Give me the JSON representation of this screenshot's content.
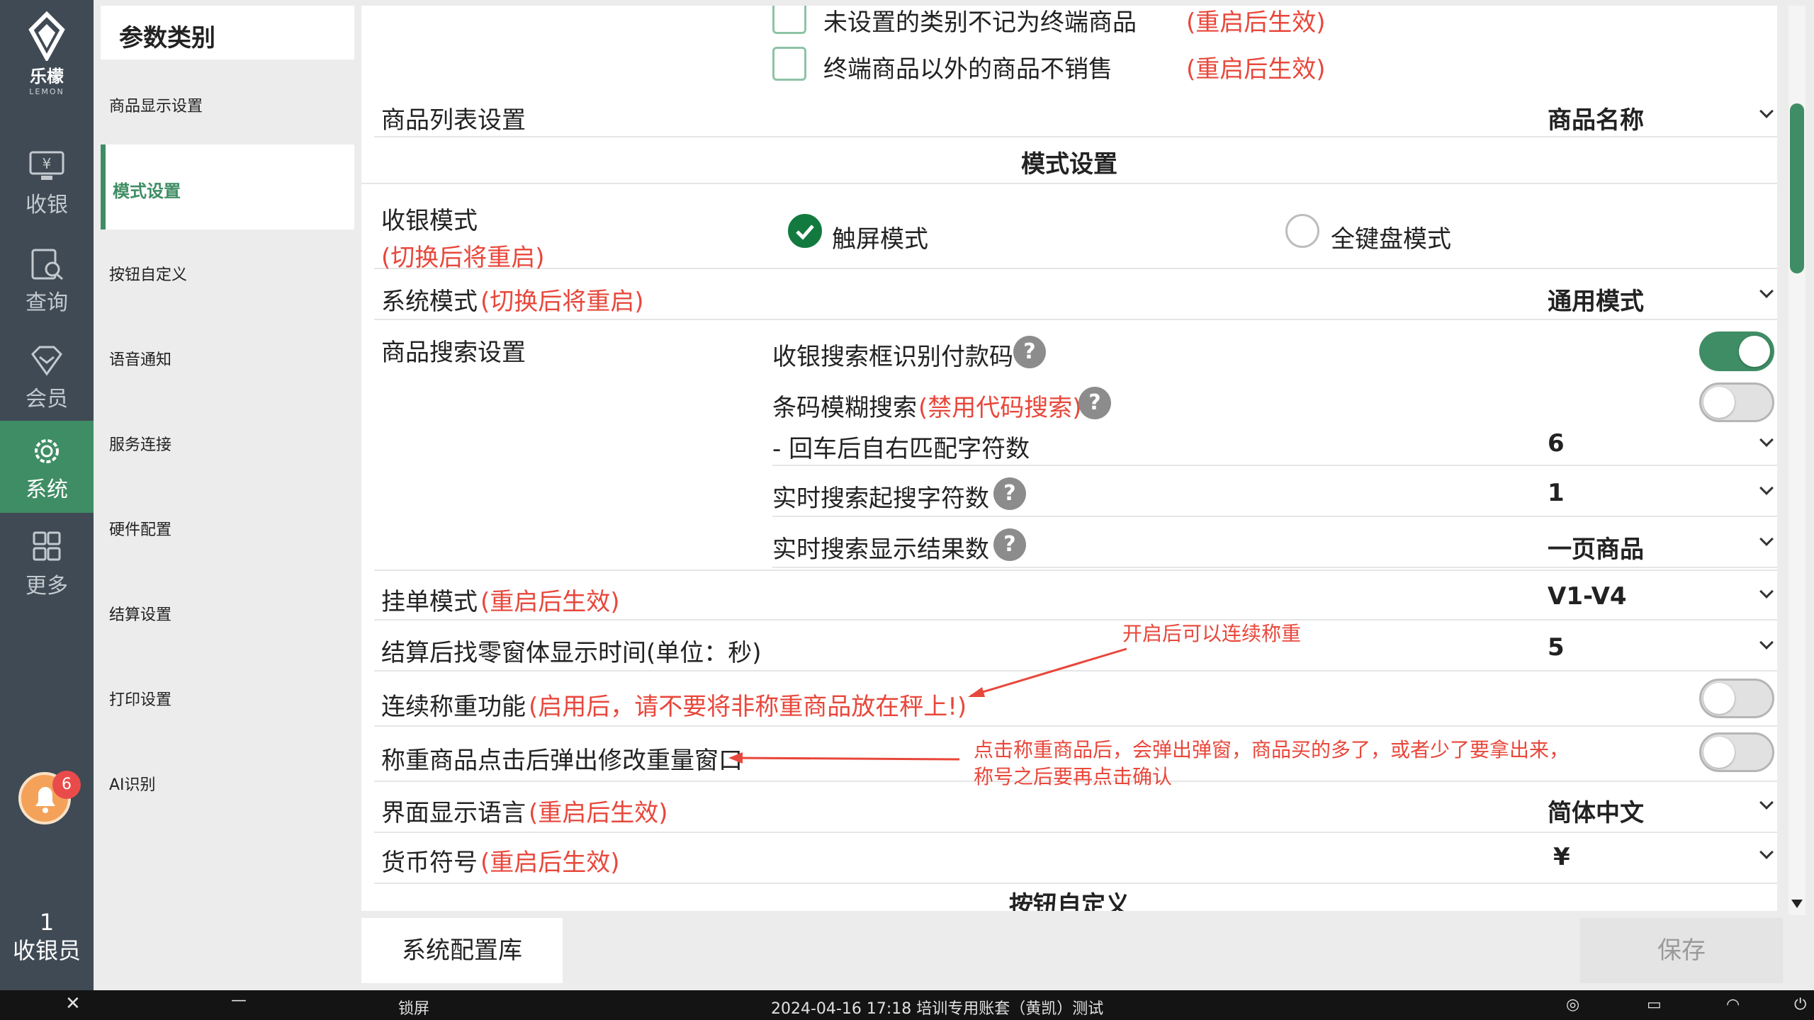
{
  "nav": {
    "logo_cn": "乐檬",
    "logo_en": "LEMON",
    "items": [
      {
        "label": "收银",
        "icon": "cashier-monitor-icon"
      },
      {
        "label": "查询",
        "icon": "search-document-icon"
      },
      {
        "label": "会员",
        "icon": "member-diamond-icon"
      },
      {
        "label": "系统",
        "icon": "gear-icon"
      },
      {
        "label": "更多",
        "icon": "grid-icon"
      }
    ],
    "active": "系统",
    "notification_count": "6",
    "cashier_id": "1",
    "cashier_label": "收银员"
  },
  "categories": {
    "title": "参数类别",
    "items": [
      "商品显示设置",
      "模式设置",
      "按钮自定义",
      "语音通知",
      "服务连接",
      "硬件配置",
      "结算设置",
      "打印设置",
      "AI识别"
    ],
    "active": "模式设置"
  },
  "settings": {
    "cb1_label": "未设置的类别不记为终端商品",
    "cb1_note": "(重启后生效)",
    "cb2_label": "终端商品以外的商品不销售",
    "cb2_note": "(重启后生效)",
    "product_list_label": "商品列表设置",
    "product_list_value": "商品名称",
    "mode_section": "模式设置",
    "cashier_mode_label": "收银模式",
    "cashier_mode_note": "(切换后将重启)",
    "radio_touch": "触屏模式",
    "radio_keyboard": "全键盘模式",
    "system_mode_label": "系统模式",
    "system_mode_note": "(切换后将重启)",
    "system_mode_value": "通用模式",
    "search_settings_label": "商品搜索设置",
    "search_pay_code": "收银搜索框识别付款码",
    "barcode_fuzzy": "条码模糊搜索",
    "barcode_fuzzy_note": "(禁用代码搜索)",
    "right_match_label": "- 回车后自右匹配字符数",
    "right_match_value": "6",
    "realtime_start_label": "实时搜索起搜字符数",
    "realtime_start_value": "1",
    "realtime_result_label": "实时搜索显示结果数",
    "realtime_result_value": "一页商品",
    "hold_mode_label": "挂单模式",
    "hold_mode_note": "(重启后生效)",
    "hold_mode_value": "V1-V4",
    "change_window_label": "结算后找零窗体显示时间(单位：秒)",
    "change_window_value": "5",
    "continuous_weigh_label": "连续称重功能",
    "continuous_weigh_note": "(启用后，请不要将非称重商品放在秤上!)",
    "weigh_popup_label": "称重商品点击后弹出修改重量窗口",
    "language_label": "界面显示语言",
    "language_note": "(重启后生效)",
    "language_value": "简体中文",
    "currency_label": "货币符号",
    "currency_note": "(重启后生效)",
    "currency_value": "¥",
    "buttons_section": "按钮自定义",
    "toggle_pay_code": true,
    "toggle_fuzzy": false,
    "toggle_continuous": false,
    "toggle_popup": false
  },
  "annotations": {
    "continuous_note": "开启后可以连续称重",
    "popup_note_line1": "点击称重商品后，会弹出弹窗，商品买的多了，或者少了要拿出来，",
    "popup_note_line2": "称号之后要再点击确认"
  },
  "buttons": {
    "config_library": "系统配置库",
    "save": "保存"
  },
  "statusbar": {
    "lock": "锁屏",
    "info": "2024-04-16 17:18 培训专用账套（黄凯）测试"
  },
  "colors": {
    "accent": "#3f8d64",
    "nav_bg": "#3f4a55",
    "note_red": "#e8473b"
  }
}
